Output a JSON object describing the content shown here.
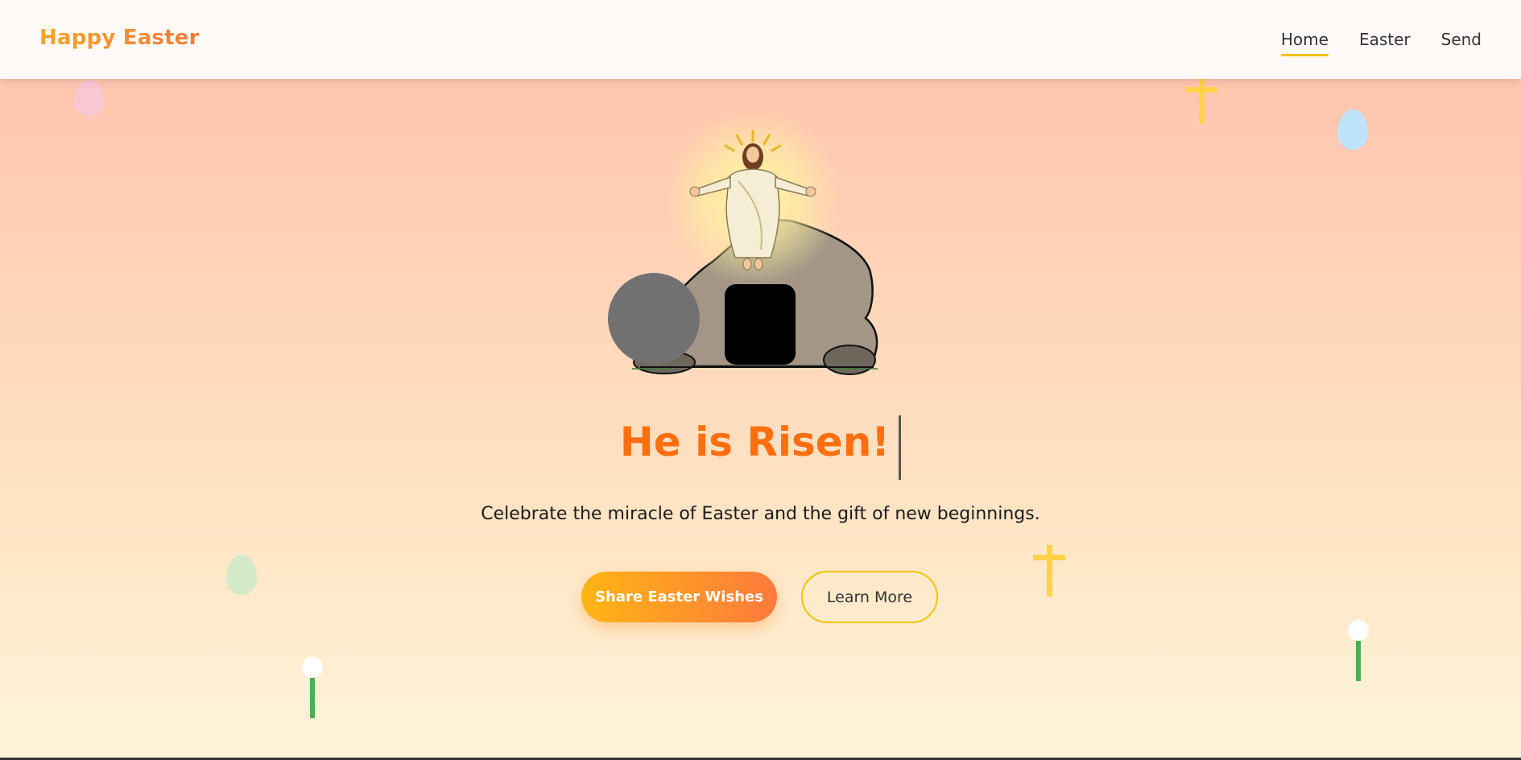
{
  "nav": {
    "brand": "Happy Easter",
    "links": [
      {
        "label": "Home",
        "active": true
      },
      {
        "label": "Easter",
        "active": false
      },
      {
        "label": "Send",
        "active": false
      }
    ]
  },
  "hero": {
    "title": "He is Risen!",
    "subtitle": "Celebrate the miracle of Easter and the gift of new beginnings.",
    "primary_button": "Share Easter Wishes",
    "secondary_button": "Learn More"
  },
  "colors": {
    "brand_gradient_start": "#f5a623",
    "brand_gradient_end": "#f07a3c",
    "title": "#ff6f0f",
    "accent_yellow": "#f5c400",
    "button_gradient_start": "#ffb414",
    "button_gradient_end": "#ff7a3c"
  },
  "decorations": {
    "eggs": [
      "pink-egg",
      "blue-egg",
      "green-egg"
    ],
    "crosses": [
      "cross-top-right",
      "cross-mid-right"
    ],
    "flowers": [
      "white-flower-left",
      "white-flower-right"
    ]
  }
}
